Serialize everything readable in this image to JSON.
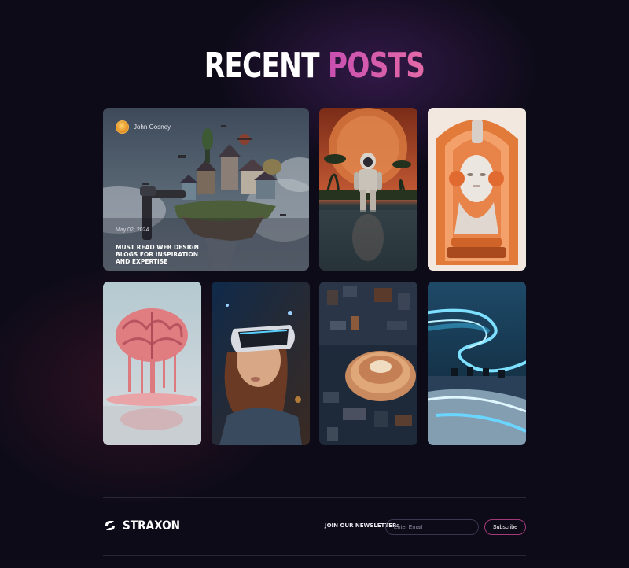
{
  "section": {
    "title_part1": "RECENT",
    "title_part2": "POSTS"
  },
  "colors": {
    "background": "#0d0b18",
    "accent": "#c84fb0"
  },
  "posts": [
    {
      "author": "John Gosney",
      "date": "May 02, 2024",
      "title": "MUST READ WEB DESIGN BLOGS FOR INSPIRATION AND EXPERTISE",
      "image": "floating-island-houses-image"
    },
    {
      "image": "astronaut-in-water-image"
    },
    {
      "image": "robot-head-sculpture-image"
    },
    {
      "image": "melting-brain-image"
    },
    {
      "image": "vr-headset-girl-image"
    },
    {
      "image": "circuit-board-chip-image"
    },
    {
      "image": "neon-futuristic-room-image"
    }
  ],
  "footer": {
    "brand": "STRAXON",
    "newsletter_label": "JOIN OUR NEWSLETTER:",
    "email_placeholder": "Enter Email",
    "subscribe_label": "Subscribe"
  }
}
